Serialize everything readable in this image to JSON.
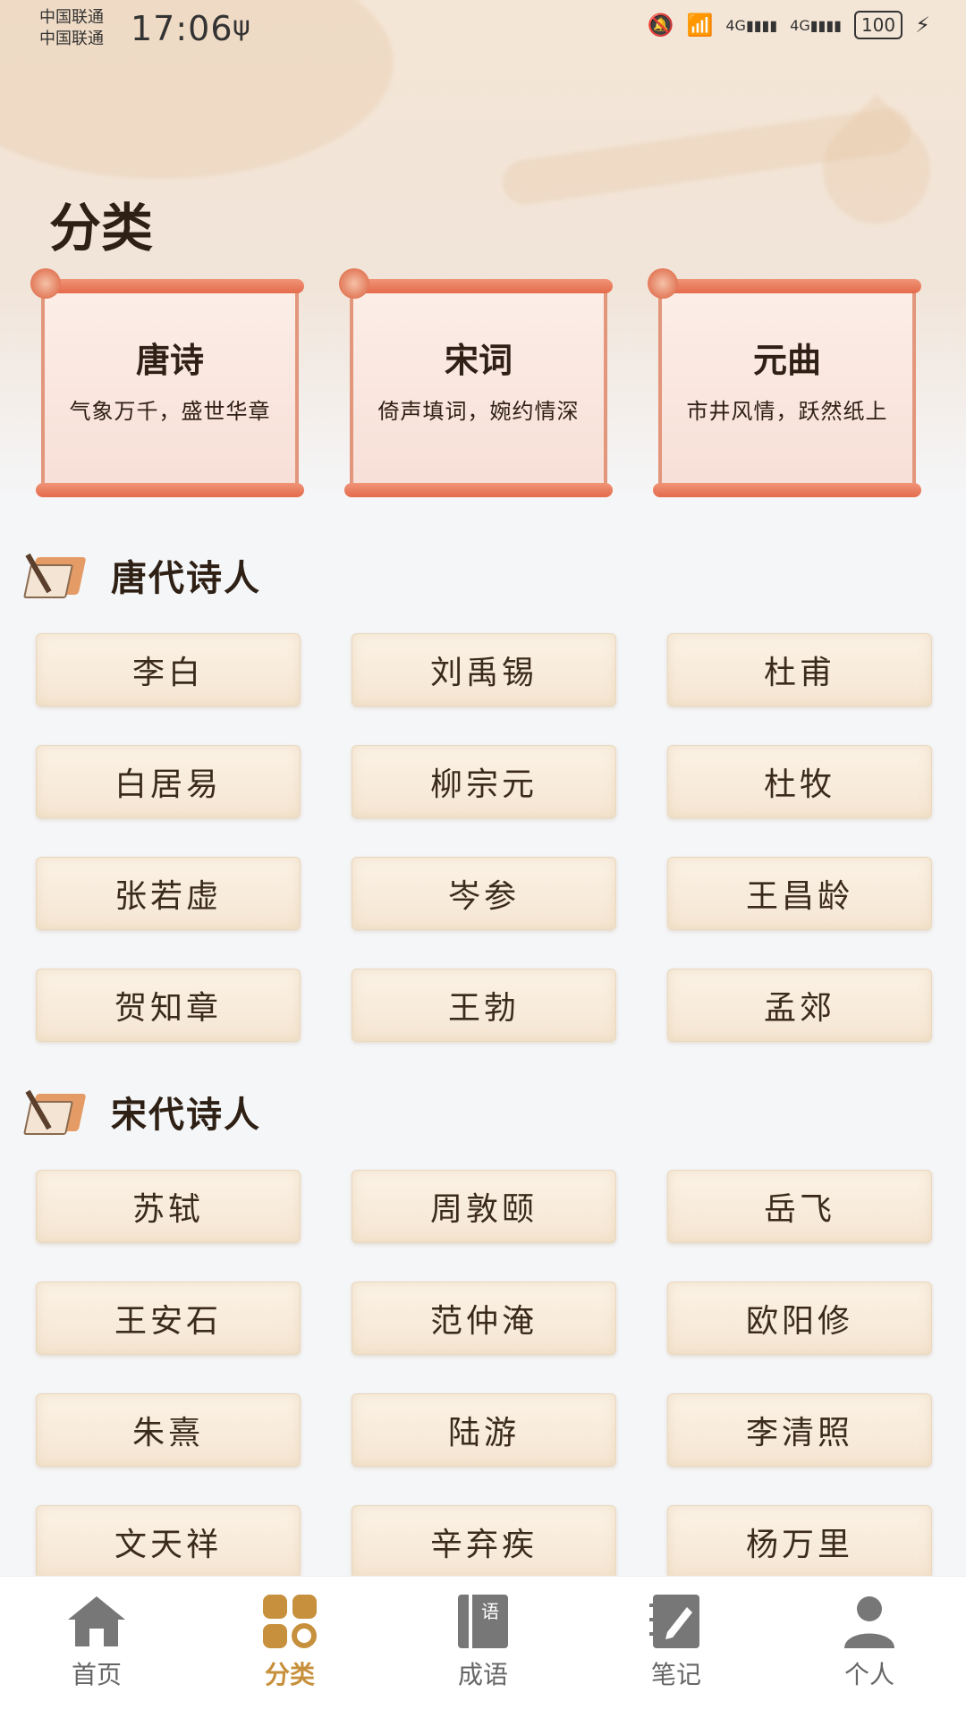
{
  "status_bar": {
    "carrier1": "中国联通",
    "carrier2": "中国联通",
    "time": "17:06",
    "usb": "ψ",
    "network": "4G",
    "network2": "4G",
    "battery": "100"
  },
  "page_title": "分类",
  "categories": [
    {
      "name": "唐诗",
      "desc": "气象万千，盛世华章"
    },
    {
      "name": "宋词",
      "desc": "倚声填词，婉约情深"
    },
    {
      "name": "元曲",
      "desc": "市井风情，跃然纸上"
    }
  ],
  "sections": [
    {
      "title": "唐代诗人",
      "poets": [
        "李白",
        "刘禹锡",
        "杜甫",
        "白居易",
        "柳宗元",
        "杜牧",
        "张若虚",
        "岑参",
        "王昌龄",
        "贺知章",
        "王勃",
        "孟郊"
      ]
    },
    {
      "title": "宋代诗人",
      "poets": [
        "苏轼",
        "周敦颐",
        "岳飞",
        "王安石",
        "范仲淹",
        "欧阳修",
        "朱熹",
        "陆游",
        "李清照",
        "文天祥",
        "辛弃疾",
        "杨万里"
      ]
    }
  ],
  "nav": [
    {
      "label": "首页",
      "icon": "home-icon"
    },
    {
      "label": "分类",
      "icon": "category-icon",
      "active": true
    },
    {
      "label": "成语",
      "icon": "idiom-book-icon"
    },
    {
      "label": "笔记",
      "icon": "note-icon"
    },
    {
      "label": "个人",
      "icon": "person-icon"
    }
  ],
  "idiom_icon_char": "语",
  "colors": {
    "accent": "#C7903C",
    "text": "#2E2015",
    "scroll_rod": "#E46A4B"
  }
}
